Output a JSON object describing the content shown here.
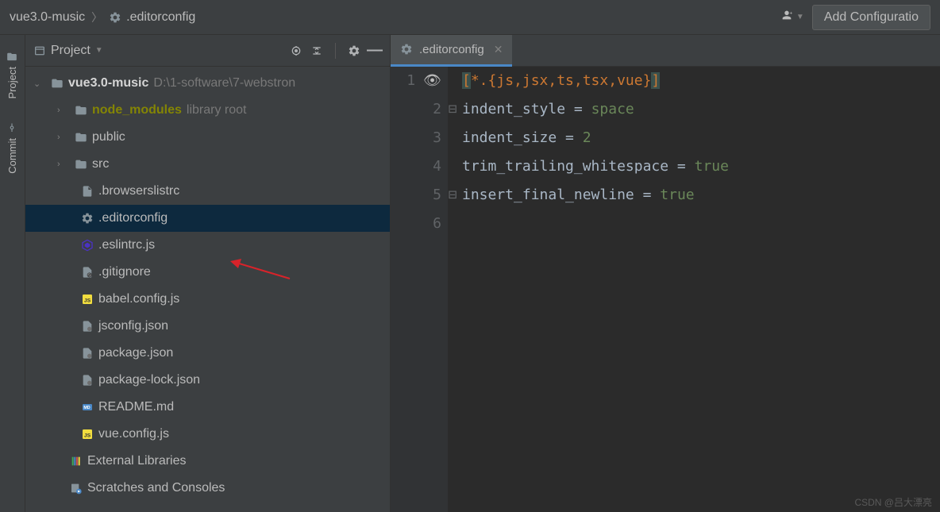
{
  "breadcrumbs": {
    "project": "vue3.0-music",
    "file": ".editorconfig"
  },
  "toolbar": {
    "add_config": "Add Configuratio"
  },
  "rail": {
    "project": "Project",
    "commit": "Commit"
  },
  "panel": {
    "title": "Project"
  },
  "tree": {
    "root": {
      "name": "vue3.0-music",
      "path": "D:\\1-software\\7-webstron"
    },
    "items": [
      {
        "name": "node_modules",
        "suffix": "library root"
      },
      {
        "name": "public"
      },
      {
        "name": "src"
      },
      {
        "name": ".browserslistrc"
      },
      {
        "name": ".editorconfig"
      },
      {
        "name": ".eslintrc.js"
      },
      {
        "name": ".gitignore"
      },
      {
        "name": "babel.config.js"
      },
      {
        "name": "jsconfig.json"
      },
      {
        "name": "package.json"
      },
      {
        "name": "package-lock.json"
      },
      {
        "name": "README.md"
      },
      {
        "name": "vue.config.js"
      }
    ],
    "external": "External Libraries",
    "scratches": "Scratches and Consoles"
  },
  "tab": {
    "name": ".editorconfig"
  },
  "code": {
    "l1": {
      "pre": "[",
      "inner": "*.{js,jsx,ts,tsx,vue}",
      "post": "]"
    },
    "l2": {
      "k": "indent_style",
      "eq": " = ",
      "v": "space"
    },
    "l3": {
      "k": "indent_size",
      "eq": " = ",
      "v": "2"
    },
    "l4": {
      "k": "trim_trailing_whitespace",
      "eq": " = ",
      "v": "true"
    },
    "l5": {
      "k": "insert_final_newline",
      "eq": " = ",
      "v": "true"
    }
  },
  "watermark": "CSDN @吕大漂亮"
}
